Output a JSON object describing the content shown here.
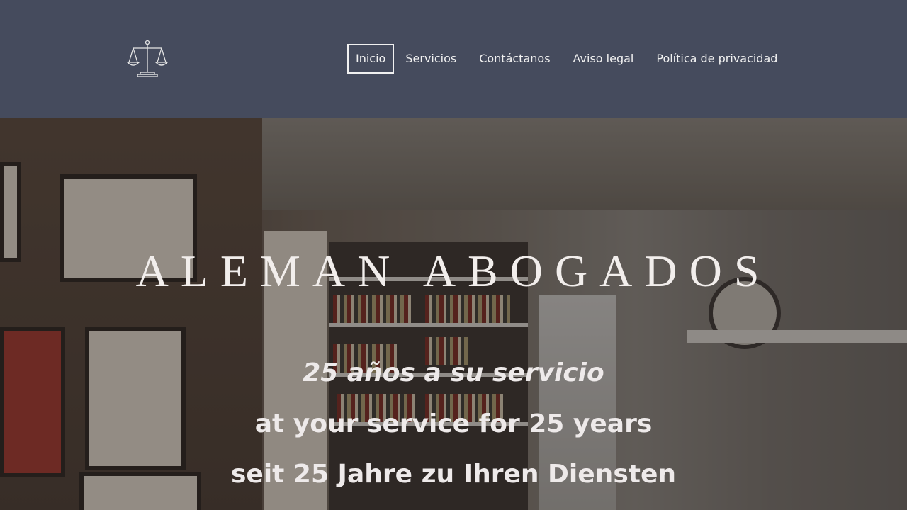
{
  "header": {
    "logo_icon": "scales-of-justice-icon",
    "nav": [
      {
        "label": "Inicio",
        "active": true
      },
      {
        "label": "Servicios",
        "active": false
      },
      {
        "label": "Contáctanos",
        "active": false
      },
      {
        "label": "Aviso legal",
        "active": false
      },
      {
        "label": "Política de privacidad",
        "active": false
      }
    ]
  },
  "hero": {
    "title": "ALEMAN ABOGADOS",
    "lines": [
      "25 años a  su servicio",
      "at your service for 25 years",
      "seit 25 Jahre zu Ihren Diensten"
    ]
  },
  "colors": {
    "header_bg": "#454b5d",
    "text": "#f1f1f1"
  }
}
